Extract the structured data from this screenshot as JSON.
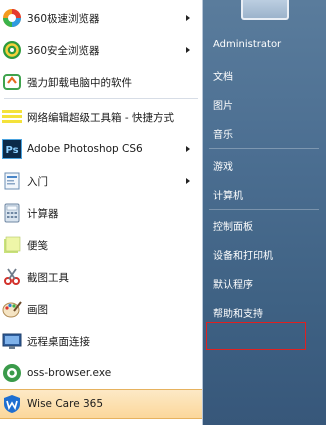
{
  "left_items": [
    {
      "label": "360极速浏览器",
      "icon": "360-speed-browser-icon",
      "arrow": true
    },
    {
      "label": "360安全浏览器",
      "icon": "360-safe-browser-icon",
      "arrow": true
    },
    {
      "label": "强力卸载电脑中的软件",
      "icon": "uninstall-icon",
      "arrow": false
    },
    {
      "label": "网络编辑超级工具箱 - 快捷方式",
      "icon": "toolbox-shortcut-icon",
      "arrow": false
    },
    {
      "label": "Adobe Photoshop CS6",
      "icon": "photoshop-icon",
      "arrow": true
    },
    {
      "label": "入门",
      "icon": "getting-started-icon",
      "arrow": true
    },
    {
      "label": "计算器",
      "icon": "calculator-icon",
      "arrow": false
    },
    {
      "label": "便笺",
      "icon": "sticky-notes-icon",
      "arrow": false
    },
    {
      "label": "截图工具",
      "icon": "snipping-tool-icon",
      "arrow": false
    },
    {
      "label": "画图",
      "icon": "paint-icon",
      "arrow": false
    },
    {
      "label": "远程桌面连接",
      "icon": "remote-desktop-icon",
      "arrow": false
    },
    {
      "label": "oss-browser.exe",
      "icon": "oss-browser-icon",
      "arrow": false
    },
    {
      "label": "Wise Care 365",
      "icon": "wise-care-icon",
      "arrow": false
    }
  ],
  "right_items": [
    {
      "label": "Administrator"
    },
    {
      "label": "文档"
    },
    {
      "label": "图片"
    },
    {
      "label": "音乐"
    },
    {
      "label": "游戏"
    },
    {
      "label": "计算机"
    },
    {
      "label": "控制面板"
    },
    {
      "label": "设备和打印机"
    },
    {
      "label": "默认程序"
    },
    {
      "label": "帮助和支持"
    }
  ],
  "colors": {
    "right_panel": "#4c6f92",
    "highlight": "#fbd79b",
    "red_box": "#e02020"
  }
}
